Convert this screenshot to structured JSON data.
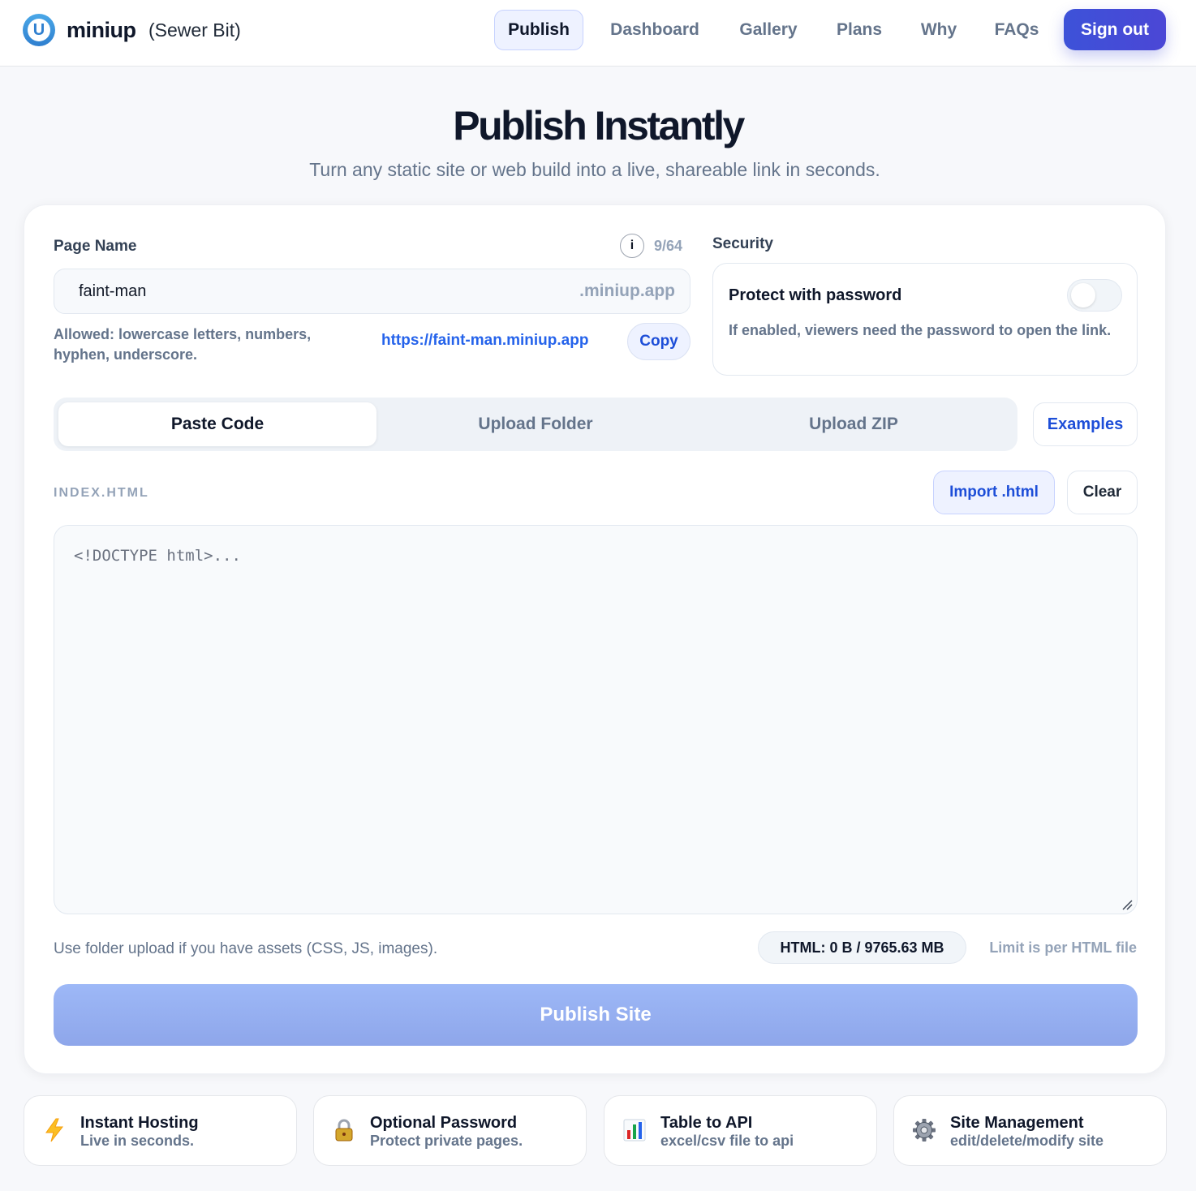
{
  "header": {
    "logo_letter": "U",
    "brand": "miniup",
    "workspace": "(Sewer Bit)",
    "nav": [
      "Publish",
      "Dashboard",
      "Gallery",
      "Plans",
      "Why",
      "FAQs"
    ],
    "active_nav": "Publish",
    "signout_label": "Sign out"
  },
  "hero": {
    "title": "Publish Instantly",
    "subtitle": "Turn any static site or web build into a live, shareable link in seconds."
  },
  "form": {
    "page_name_label": "Page Name",
    "info_icon_glyph": "i",
    "char_counter": "9/64",
    "page_name_value": "faint-man",
    "domain_suffix": ".miniup.app",
    "allowed_hint": "Allowed: lowercase letters, numbers, hyphen, underscore.",
    "url": "https://faint-man.miniup.app",
    "copy_label": "Copy",
    "security_label": "Security",
    "protect_title": "Protect with password",
    "protect_enabled": false,
    "protect_desc": "If enabled, viewers need the password to open the link.",
    "tabs": [
      "Paste Code",
      "Upload Folder",
      "Upload ZIP"
    ],
    "active_tab": "Paste Code",
    "examples_label": "Examples",
    "file_label": "INDEX.HTML",
    "import_label": "Import .html",
    "clear_label": "Clear",
    "code_placeholder": "<!DOCTYPE html>...",
    "assets_note": "Use folder upload if you have assets (CSS, JS, images).",
    "size_status": "HTML: 0 B / 9765.63 MB",
    "limit_note": "Limit is per HTML file",
    "publish_label": "Publish Site"
  },
  "features": [
    {
      "icon": "lightning-icon",
      "title": "Instant Hosting",
      "desc": "Live in seconds."
    },
    {
      "icon": "lock-icon",
      "title": "Optional Password",
      "desc": "Protect private pages."
    },
    {
      "icon": "bar-chart-icon",
      "title": "Table to API",
      "desc": "excel/csv file to api"
    },
    {
      "icon": "gear-icon",
      "title": "Site Management",
      "desc": "edit/delete/modify site"
    }
  ],
  "colors": {
    "accent": "#3d52d8",
    "link": "#2563eb",
    "publish_disabled": "#97b0f2",
    "page_bg": "#f7f8fb"
  }
}
